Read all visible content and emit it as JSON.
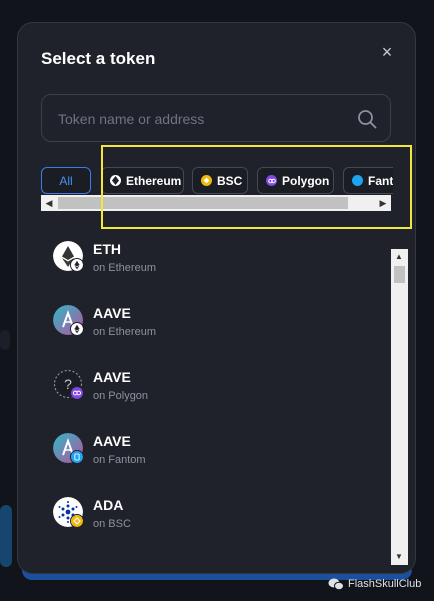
{
  "modal": {
    "title": "Select a token",
    "close_symbol": "×"
  },
  "search": {
    "placeholder": "Token name or address",
    "value": ""
  },
  "network_filters": [
    {
      "label": "All",
      "selected": true,
      "color": "#3e7be8"
    },
    {
      "label": "Ethereum",
      "selected": false,
      "color": "#ffffff"
    },
    {
      "label": "BSC",
      "selected": false,
      "color": "#f0b90b"
    },
    {
      "label": "Polygon",
      "selected": false,
      "color": "#8247e5"
    },
    {
      "label": "Fantom",
      "selected": false,
      "color": "#1fa4f1"
    }
  ],
  "tokens": [
    {
      "symbol": "ETH",
      "network": "on Ethereum",
      "logo_icon": "ethereum-logo-icon",
      "badge_icon": "ethereum-badge-icon"
    },
    {
      "symbol": "AAVE",
      "network": "on Ethereum",
      "logo_icon": "aave-logo-icon",
      "badge_icon": "ethereum-badge-icon"
    },
    {
      "symbol": "AAVE",
      "network": "on Polygon",
      "logo_icon": "unknown-token-icon",
      "badge_icon": "polygon-badge-icon"
    },
    {
      "symbol": "AAVE",
      "network": "on Fantom",
      "logo_icon": "aave-logo-icon",
      "badge_icon": "fantom-badge-icon"
    },
    {
      "symbol": "ADA",
      "network": "on BSC",
      "logo_icon": "cardano-logo-icon",
      "badge_icon": "bsc-badge-icon"
    }
  ],
  "watermark": {
    "text": "FlashSkullClub"
  },
  "colors": {
    "accent": "#3e7be8",
    "highlight_box": "#f2e83a",
    "modal_bg": "#1f222a"
  }
}
